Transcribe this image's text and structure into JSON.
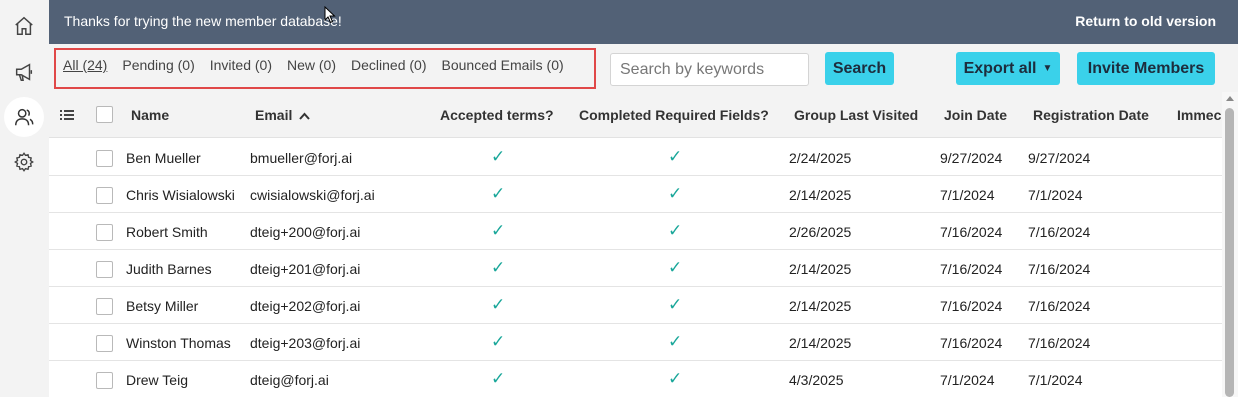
{
  "rail": {
    "items": [
      {
        "icon": "home-icon"
      },
      {
        "icon": "megaphone-icon"
      },
      {
        "icon": "members-icon"
      },
      {
        "icon": "gear-icon"
      }
    ]
  },
  "banner": {
    "text": "Thanks for trying the new member database!",
    "return_link": "Return to old version"
  },
  "filters": {
    "tabs": [
      {
        "label": "All (24)"
      },
      {
        "label": "Pending (0)"
      },
      {
        "label": "Invited (0)"
      },
      {
        "label": "New (0)"
      },
      {
        "label": "Declined (0)"
      },
      {
        "label": "Bounced Emails (0)"
      }
    ]
  },
  "search": {
    "placeholder": "Search by keywords",
    "value": "",
    "button_label": "Search"
  },
  "actions": {
    "export_label": "Export all",
    "invite_label": "Invite Members"
  },
  "table": {
    "columns": {
      "name": "Name",
      "email": "Email",
      "accepted_terms": "Accepted terms?",
      "completed_fields": "Completed Required Fields?",
      "group_last_visited": "Group Last Visited",
      "join_date": "Join Date",
      "registration_date": "Registration Date",
      "overflow": "Immec"
    },
    "sort": {
      "column": "email",
      "direction": "ascending"
    },
    "rows": [
      {
        "name": "Ben Mueller",
        "email": "bmueller@forj.ai",
        "accepted_terms": true,
        "completed_fields": true,
        "group_last_visited": "2/24/2025",
        "join_date": "9/27/2024",
        "registration_date": "9/27/2024"
      },
      {
        "name": "Chris Wisialowski",
        "email": "cwisialowski@forj.ai",
        "accepted_terms": true,
        "completed_fields": true,
        "group_last_visited": "2/14/2025",
        "join_date": "7/1/2024",
        "registration_date": "7/1/2024"
      },
      {
        "name": "Robert Smith",
        "email": "dteig+200@forj.ai",
        "accepted_terms": true,
        "completed_fields": true,
        "group_last_visited": "2/26/2025",
        "join_date": "7/16/2024",
        "registration_date": "7/16/2024"
      },
      {
        "name": "Judith Barnes",
        "email": "dteig+201@forj.ai",
        "accepted_terms": true,
        "completed_fields": true,
        "group_last_visited": "2/14/2025",
        "join_date": "7/16/2024",
        "registration_date": "7/16/2024"
      },
      {
        "name": "Betsy Miller",
        "email": "dteig+202@forj.ai",
        "accepted_terms": true,
        "completed_fields": true,
        "group_last_visited": "2/14/2025",
        "join_date": "7/16/2024",
        "registration_date": "7/16/2024"
      },
      {
        "name": "Winston Thomas",
        "email": "dteig+203@forj.ai",
        "accepted_terms": true,
        "completed_fields": true,
        "group_last_visited": "2/14/2025",
        "join_date": "7/16/2024",
        "registration_date": "7/16/2024"
      },
      {
        "name": "Drew Teig",
        "email": "dteig@forj.ai",
        "accepted_terms": true,
        "completed_fields": true,
        "group_last_visited": "4/3/2025",
        "join_date": "7/1/2024",
        "registration_date": "7/1/2024"
      }
    ]
  },
  "colors": {
    "banner_bg": "#526176",
    "accent": "#3ad1ea",
    "check": "#1aa79a",
    "highlight_border": "#e04848"
  }
}
